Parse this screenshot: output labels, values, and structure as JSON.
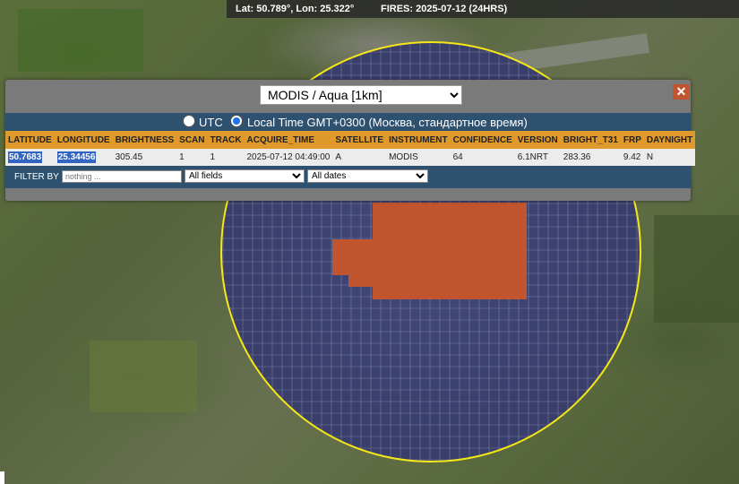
{
  "topbar": {
    "coords": "Lat: 50.789°, Lon: 25.322°",
    "fires": "FIRES: 2025-07-12 (24HRS)"
  },
  "popup": {
    "layer_select": "MODIS / Aqua [1km]",
    "close_icon": "✕",
    "timezone": {
      "utc_label": "UTC",
      "local_label": "Local Time GMT+0300 (Москва, стандартное время)",
      "selected": "local"
    },
    "table": {
      "headers": [
        "LATITUDE",
        "LONGITUDE",
        "BRIGHTNESS",
        "SCAN",
        "TRACK",
        "ACQUIRE_TIME",
        "SATELLITE",
        "INSTRUMENT",
        "CONFIDENCE",
        "VERSION",
        "BRIGHT_T31",
        "FRP",
        "DAYNIGHT"
      ],
      "row": [
        "50.7683",
        "25.34456",
        "305.45",
        "1",
        "1",
        "2025-07-12 04:49:00",
        "A",
        "MODIS",
        "64",
        "6.1NRT",
        "283.36",
        "9.42",
        "N"
      ]
    },
    "filter": {
      "label": "FILTER BY",
      "placeholder": "nothing ...",
      "field_select": "All fields",
      "date_select": "All dates"
    }
  },
  "colors": {
    "ring": "#f5e61a",
    "hotspot": "#c0552f",
    "header": "#e09a2b",
    "panel": "#2f5170"
  }
}
